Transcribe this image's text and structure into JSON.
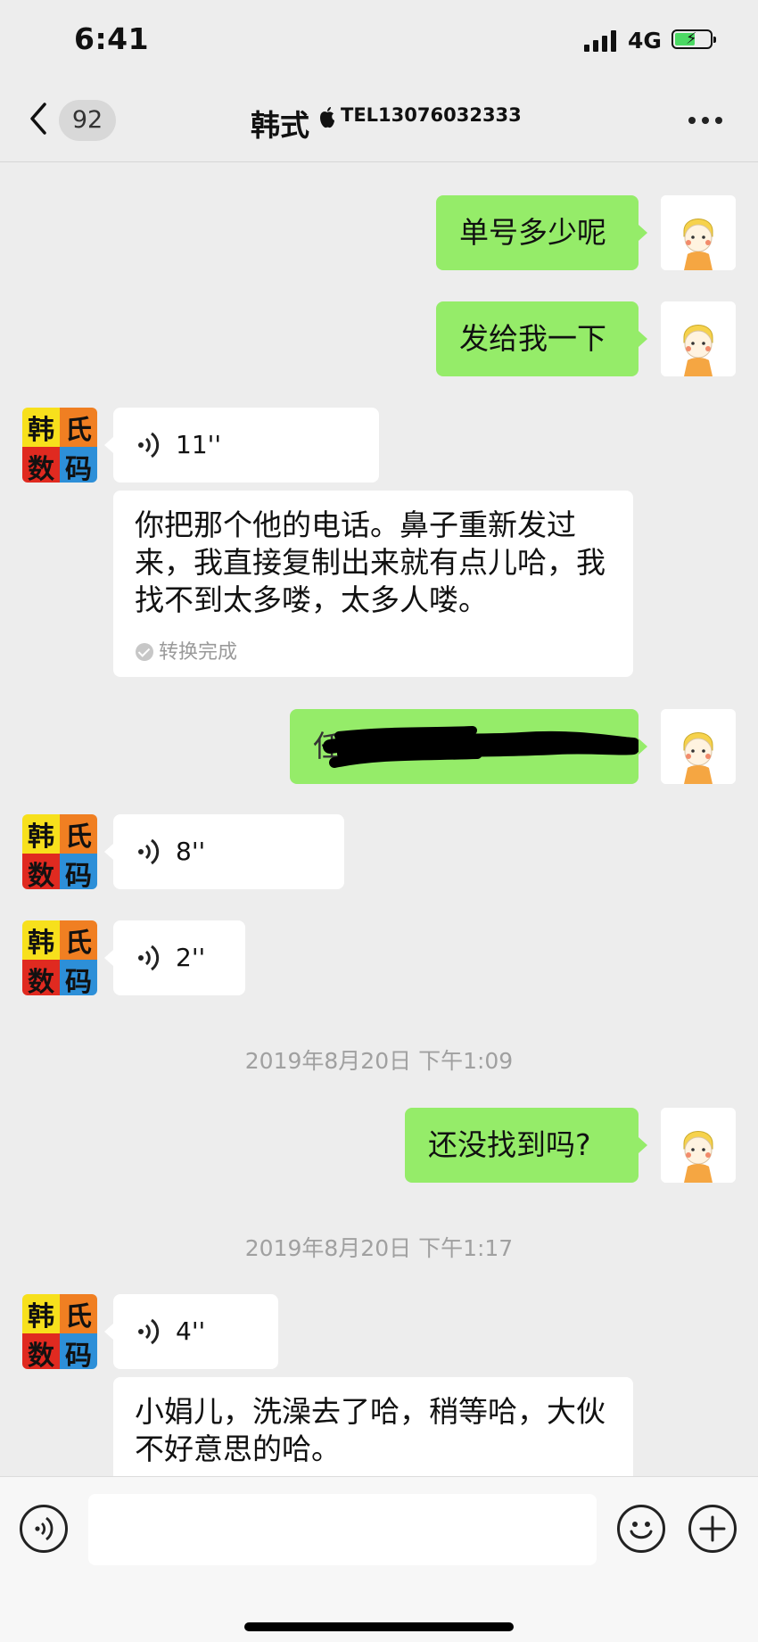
{
  "status_bar": {
    "time": "6:41",
    "network": "4G"
  },
  "nav": {
    "unread_count": "92",
    "title": "韩式",
    "subtitle": "TEL13076032333"
  },
  "messages": {
    "m1": "单号多少呢",
    "m2": "发给我一下",
    "m3_duration": "11''",
    "m3_transcript": "你把那个他的电话。鼻子重新发过来，我直接复制出来就有点儿哈，我找不到太多喽，太多人喽。",
    "m3_status": "转换完成",
    "m4_visible": "任",
    "m5_duration": "8''",
    "m6_duration": "2''",
    "ts1": "2019年8月20日 下午1:09",
    "m7": "还没找到吗?",
    "ts2": "2019年8月20日 下午1:17",
    "m8_duration": "4''",
    "m8_transcript": "小娟儿，洗澡去了哈，稍等哈，大伙不好意思的哈。"
  },
  "logo_avatar": {
    "tl": "韩",
    "tr": "氏",
    "bl": "数",
    "br": "码"
  },
  "colors": {
    "my_bubble": "#95ec69",
    "their_bubble": "#ffffff",
    "background": "#ededed"
  }
}
